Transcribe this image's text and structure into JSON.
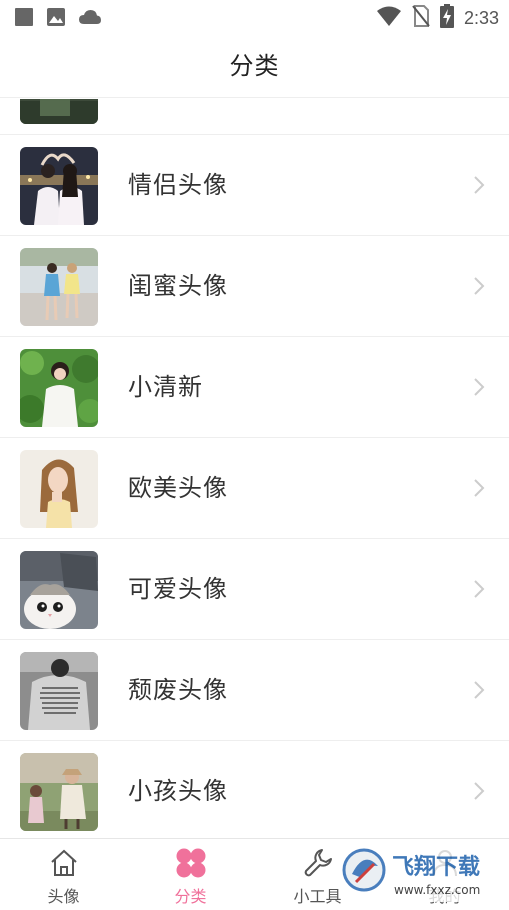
{
  "status_bar": {
    "time": "2:33",
    "left_icons": [
      "square-notification-icon",
      "image-notification-icon",
      "cloud-notification-icon"
    ],
    "right_icons": [
      "wifi-icon",
      "no-sim-icon",
      "battery-charging-icon"
    ]
  },
  "header": {
    "title": "分类"
  },
  "categories": [
    {
      "label": "",
      "partial": true
    },
    {
      "label": "情侣头像"
    },
    {
      "label": "闺蜜头像"
    },
    {
      "label": "小清新"
    },
    {
      "label": "欧美头像"
    },
    {
      "label": "可爱头像"
    },
    {
      "label": "颓废头像"
    },
    {
      "label": "小孩头像"
    }
  ],
  "tab_bar": {
    "tabs": [
      {
        "label": "头像",
        "icon": "house-icon",
        "active": false
      },
      {
        "label": "分类",
        "icon": "clover-icon",
        "active": true
      },
      {
        "label": "小工具",
        "icon": "wrench-icon",
        "active": false
      },
      {
        "label": "我的",
        "icon": "person-icon",
        "active": false
      }
    ]
  },
  "watermark": {
    "brand": "飞翔下载",
    "url": "www.fxxz.com"
  },
  "colors": {
    "accent": "#f0719b",
    "text": "#333333",
    "divider": "#eeeeee",
    "chevron": "#cccccc"
  }
}
